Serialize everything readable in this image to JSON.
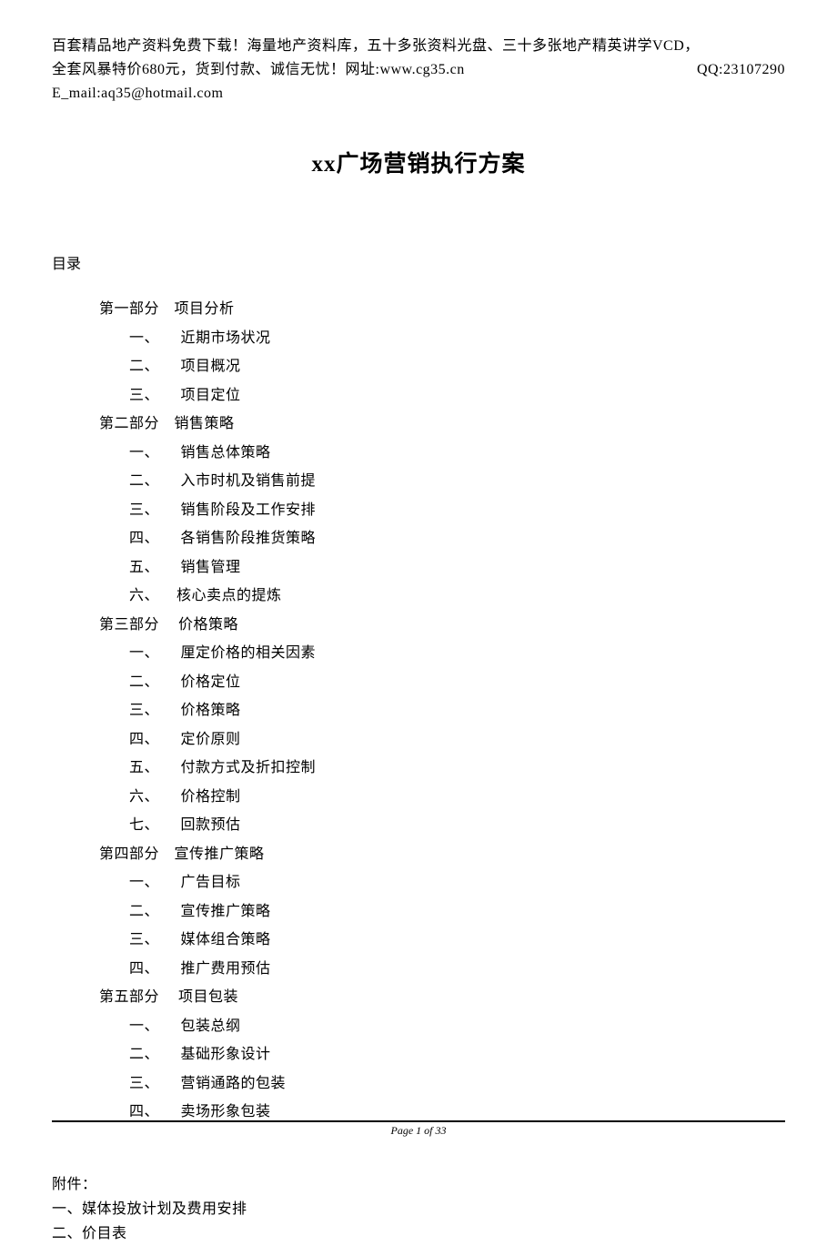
{
  "header": {
    "line1": "百套精品地产资料免费下载！海量地产资料库，五十多张资料光盘、三十多张地产精英讲学VCD，",
    "line2_left": "全套风暴特价680元，货到付款、诚信无忧！网址:www.cg35.cn",
    "line2_right": "QQ:23107290",
    "line3": "E_mail:aq35@hotmail.com"
  },
  "title": "xx广场营销执行方案",
  "toc_heading": "目录",
  "parts": [
    {
      "label": "第一部分　项目分析",
      "items": [
        {
          "num": "一、",
          "text": " 近期市场状况"
        },
        {
          "num": "二、",
          "text": " 项目概况"
        },
        {
          "num": "三、",
          "text": " 项目定位"
        }
      ]
    },
    {
      "label": "第二部分　销售策略",
      "items": [
        {
          "num": "一、",
          "text": " 销售总体策略"
        },
        {
          "num": "二、",
          "text": " 入市时机及销售前提"
        },
        {
          "num": "三、",
          "text": " 销售阶段及工作安排"
        },
        {
          "num": "四、",
          "text": " 各销售阶段推货策略"
        },
        {
          "num": "五、",
          "text": " 销售管理"
        },
        {
          "num": "六、",
          "text": "核心卖点的提炼"
        }
      ]
    },
    {
      "label": "第三部分 　价格策略",
      "items": [
        {
          "num": "一、",
          "text": " 厘定价格的相关因素"
        },
        {
          "num": "二、",
          "text": " 价格定位"
        },
        {
          "num": "三、",
          "text": " 价格策略"
        },
        {
          "num": "四、",
          "text": " 定价原则"
        },
        {
          "num": "五、",
          "text": " 付款方式及折扣控制"
        },
        {
          "num": "六、",
          "text": " 价格控制"
        },
        {
          "num": "七、",
          "text": " 回款预估"
        }
      ]
    },
    {
      "label": " 第四部分　宣传推广策略",
      "items": [
        {
          "num": "一、",
          "text": " 广告目标"
        },
        {
          "num": "二、",
          "text": " 宣传推广策略"
        },
        {
          "num": "三、",
          "text": " 媒体组合策略"
        },
        {
          "num": "四、",
          "text": " 推广费用预估"
        }
      ]
    },
    {
      "label": "第五部分 　项目包装",
      "items": [
        {
          "num": "一、",
          "text": " 包装总纲"
        },
        {
          "num": "二、",
          "text": " 基础形象设计"
        },
        {
          "num": "三、",
          "text": " 营销通路的包装"
        },
        {
          "num": "四、",
          "text": " 卖场形象包装"
        }
      ]
    }
  ],
  "attachment": {
    "heading": "附件：",
    "item1": "一、媒体投放计划及费用安排",
    "item2": "二、价目表"
  },
  "footer": "Page 1 of 33"
}
